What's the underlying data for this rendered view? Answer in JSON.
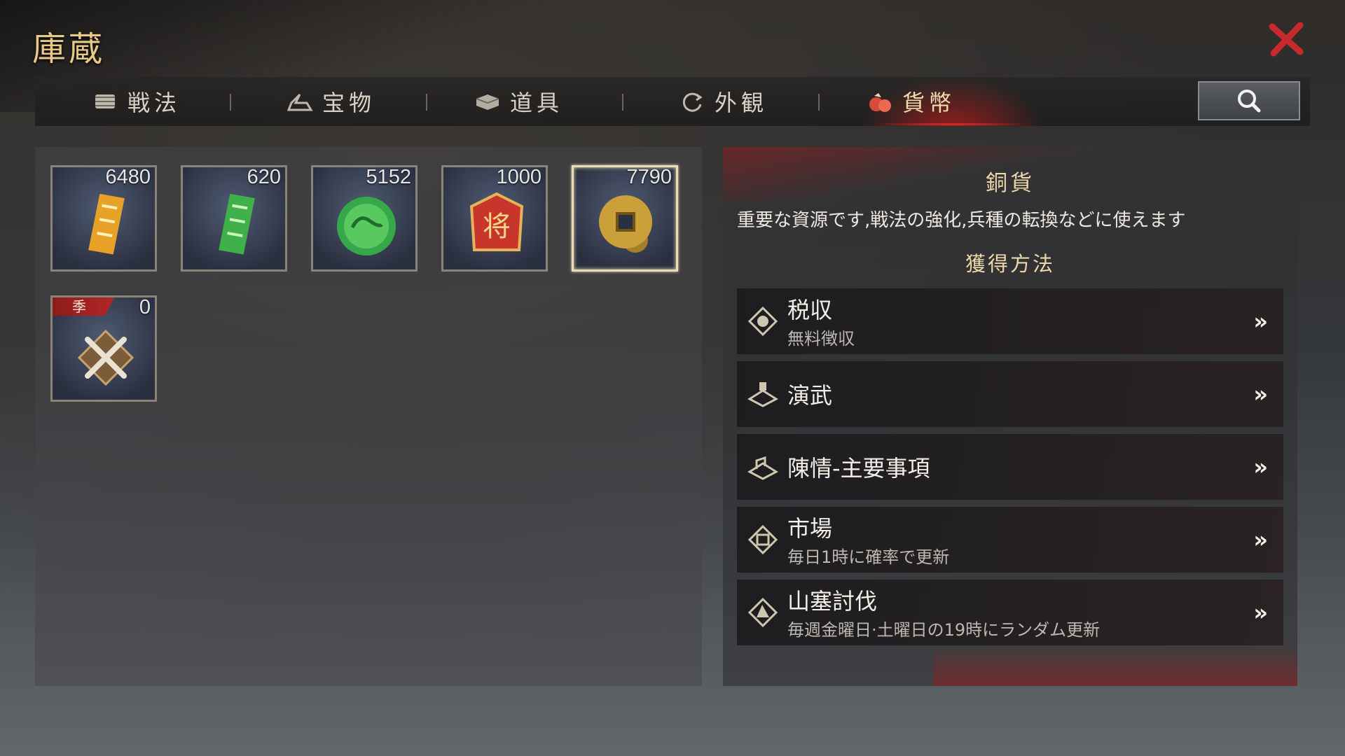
{
  "window": {
    "title": "庫蔵"
  },
  "tabs": [
    {
      "label": "戦法",
      "icon": "scroll-icon"
    },
    {
      "label": "宝物",
      "icon": "treasure-icon"
    },
    {
      "label": "道具",
      "icon": "box-icon"
    },
    {
      "label": "外観",
      "icon": "swirl-icon"
    },
    {
      "label": "貨幣",
      "icon": "money-bag-icon",
      "active": true
    }
  ],
  "items": [
    {
      "count": "6480",
      "icon": "gold-token-icon",
      "color": "#e8a227"
    },
    {
      "count": "620",
      "icon": "jade-token-icon",
      "color": "#3fb04a"
    },
    {
      "count": "5152",
      "icon": "jade-dragon-coin-icon",
      "color": "#35a84a"
    },
    {
      "count": "1000",
      "icon": "general-seal-icon",
      "color": "#c8362b",
      "glyph": "将"
    },
    {
      "count": "7790",
      "icon": "copper-coin-icon",
      "color": "#c9a03a",
      "selected": true
    },
    {
      "count": "0",
      "icon": "crossed-swords-icon",
      "tag": "季"
    }
  ],
  "detail": {
    "title": "銅貨",
    "description": "重要な資源です,戦法の強化,兵種の転換などに使えます",
    "sources_heading": "獲得方法",
    "sources": [
      {
        "name": "税収",
        "sub": "無料徴収",
        "icon": "tax-icon"
      },
      {
        "name": "演武",
        "sub": "",
        "icon": "drill-icon"
      },
      {
        "name": "陳情-主要事項",
        "sub": "",
        "icon": "petition-icon"
      },
      {
        "name": "市場",
        "sub": "毎日1時に確率で更新",
        "icon": "market-icon"
      },
      {
        "name": "山塞討伐",
        "sub": "毎週金曜日·土曜日の19時にランダム更新",
        "icon": "bandit-fort-icon"
      }
    ],
    "arrow": "»"
  },
  "colors": {
    "accent": "#d12b2b",
    "gold_text": "#eed7a8"
  }
}
